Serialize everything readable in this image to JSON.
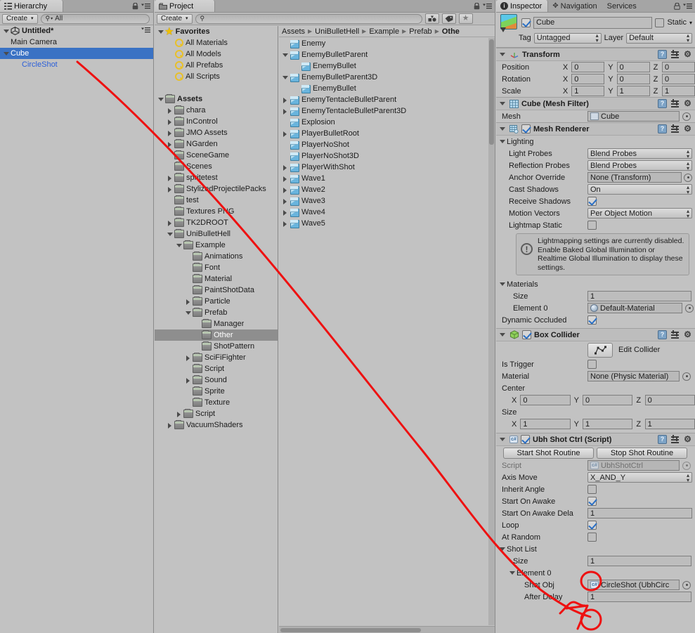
{
  "hierarchy": {
    "tab_label": "Hierarchy",
    "tab_icon": "hierarchy-icon",
    "create_label": "Create",
    "search_placeholder": "All",
    "search_value": "All",
    "scene_name": "Untitled*",
    "items": [
      {
        "label": "Main Camera",
        "depth": 1,
        "arrow": "none",
        "selected": false
      },
      {
        "label": "Cube",
        "depth": 1,
        "arrow": "down",
        "selected": true
      },
      {
        "label": "CircleShot",
        "depth": 2,
        "arrow": "none",
        "selected": false,
        "prefab": true
      }
    ]
  },
  "project": {
    "tab_label": "Project",
    "create_label": "Create",
    "search_value": "",
    "breadcrumb": [
      "Assets",
      "UniBulletHell",
      "Example",
      "Prefab",
      "Othe"
    ],
    "tree": [
      {
        "label": "Favorites",
        "depth": 0,
        "arrow": "down",
        "icon": "star-icon",
        "bold": true
      },
      {
        "label": "All Materials",
        "depth": 1,
        "arrow": "none",
        "icon": "search-icon"
      },
      {
        "label": "All Models",
        "depth": 1,
        "arrow": "none",
        "icon": "search-icon"
      },
      {
        "label": "All Prefabs",
        "depth": 1,
        "arrow": "none",
        "icon": "search-icon"
      },
      {
        "label": "All Scripts",
        "depth": 1,
        "arrow": "none",
        "icon": "search-icon"
      },
      {
        "label": "",
        "depth": 0,
        "arrow": "none",
        "icon": "none",
        "blank": true
      },
      {
        "label": "Assets",
        "depth": 0,
        "arrow": "down",
        "icon": "folder-icon",
        "bold": true
      },
      {
        "label": "chara",
        "depth": 1,
        "arrow": "right",
        "icon": "folder-icon"
      },
      {
        "label": "InControl",
        "depth": 1,
        "arrow": "right",
        "icon": "folder-icon"
      },
      {
        "label": "JMO Assets",
        "depth": 1,
        "arrow": "right",
        "icon": "folder-icon"
      },
      {
        "label": "NGarden",
        "depth": 1,
        "arrow": "right",
        "icon": "folder-icon"
      },
      {
        "label": "SceneGame",
        "depth": 1,
        "arrow": "none",
        "icon": "folder-icon"
      },
      {
        "label": "Scenes",
        "depth": 1,
        "arrow": "none",
        "icon": "folder-icon"
      },
      {
        "label": "spritetest",
        "depth": 1,
        "arrow": "right",
        "icon": "folder-icon"
      },
      {
        "label": "StylizedProjectilePacks",
        "depth": 1,
        "arrow": "right",
        "icon": "folder-icon"
      },
      {
        "label": "test",
        "depth": 1,
        "arrow": "none",
        "icon": "folder-icon"
      },
      {
        "label": "Textures PNG",
        "depth": 1,
        "arrow": "none",
        "icon": "folder-icon"
      },
      {
        "label": "TK2DROOT",
        "depth": 1,
        "arrow": "right",
        "icon": "folder-icon"
      },
      {
        "label": "UniBulletHell",
        "depth": 1,
        "arrow": "down",
        "icon": "folder-icon"
      },
      {
        "label": "Example",
        "depth": 2,
        "arrow": "down",
        "icon": "folder-icon"
      },
      {
        "label": "Animations",
        "depth": 3,
        "arrow": "none",
        "icon": "folder-icon"
      },
      {
        "label": "Font",
        "depth": 3,
        "arrow": "none",
        "icon": "folder-icon"
      },
      {
        "label": "Material",
        "depth": 3,
        "arrow": "none",
        "icon": "folder-icon"
      },
      {
        "label": "PaintShotData",
        "depth": 3,
        "arrow": "none",
        "icon": "folder-icon"
      },
      {
        "label": "Particle",
        "depth": 3,
        "arrow": "right",
        "icon": "folder-icon"
      },
      {
        "label": "Prefab",
        "depth": 3,
        "arrow": "down",
        "icon": "folder-icon"
      },
      {
        "label": "Manager",
        "depth": 4,
        "arrow": "none",
        "icon": "folder-icon"
      },
      {
        "label": "Other",
        "depth": 4,
        "arrow": "none",
        "icon": "folder-icon",
        "selected": true
      },
      {
        "label": "ShotPattern",
        "depth": 4,
        "arrow": "none",
        "icon": "folder-icon"
      },
      {
        "label": "SciFiFighter",
        "depth": 3,
        "arrow": "right",
        "icon": "folder-icon"
      },
      {
        "label": "Script",
        "depth": 3,
        "arrow": "none",
        "icon": "folder-icon"
      },
      {
        "label": "Sound",
        "depth": 3,
        "arrow": "right",
        "icon": "folder-icon"
      },
      {
        "label": "Sprite",
        "depth": 3,
        "arrow": "none",
        "icon": "folder-icon"
      },
      {
        "label": "Texture",
        "depth": 3,
        "arrow": "none",
        "icon": "folder-icon"
      },
      {
        "label": "Script",
        "depth": 2,
        "arrow": "right",
        "icon": "folder-icon"
      },
      {
        "label": "VacuumShaders",
        "depth": 1,
        "arrow": "right",
        "icon": "folder-icon"
      }
    ],
    "assets": [
      {
        "label": "Enemy",
        "depth": 1,
        "arrow": "none"
      },
      {
        "label": "EnemyBulletParent",
        "depth": 1,
        "arrow": "down"
      },
      {
        "label": "EnemyBullet",
        "depth": 2,
        "arrow": "none"
      },
      {
        "label": "EnemyBulletParent3D",
        "depth": 1,
        "arrow": "down"
      },
      {
        "label": "EnemyBullet",
        "depth": 2,
        "arrow": "none"
      },
      {
        "label": "EnemyTentacleBulletParent",
        "depth": 1,
        "arrow": "right"
      },
      {
        "label": "EnemyTentacleBulletParent3D",
        "depth": 1,
        "arrow": "right"
      },
      {
        "label": "Explosion",
        "depth": 1,
        "arrow": "none"
      },
      {
        "label": "PlayerBulletRoot",
        "depth": 1,
        "arrow": "right"
      },
      {
        "label": "PlayerNoShot",
        "depth": 1,
        "arrow": "none"
      },
      {
        "label": "PlayerNoShot3D",
        "depth": 1,
        "arrow": "none"
      },
      {
        "label": "PlayerWithShot",
        "depth": 1,
        "arrow": "right"
      },
      {
        "label": "Wave1",
        "depth": 1,
        "arrow": "right"
      },
      {
        "label": "Wave2",
        "depth": 1,
        "arrow": "right"
      },
      {
        "label": "Wave3",
        "depth": 1,
        "arrow": "right"
      },
      {
        "label": "Wave4",
        "depth": 1,
        "arrow": "right"
      },
      {
        "label": "Wave5",
        "depth": 1,
        "arrow": "right"
      }
    ]
  },
  "inspector": {
    "tabs": [
      {
        "label": "Inspector",
        "active": true,
        "icon": "info-icon"
      },
      {
        "label": "Navigation",
        "active": false,
        "icon": "navigation-icon"
      },
      {
        "label": "Services",
        "active": false,
        "icon": "none"
      }
    ],
    "object_name": "Cube",
    "object_enabled": true,
    "static_label": "Static",
    "static_checked": false,
    "tag_label": "Tag",
    "tag_value": "Untagged",
    "layer_label": "Layer",
    "layer_value": "Default",
    "transform": {
      "title": "Transform",
      "rows": [
        {
          "label": "Position",
          "x": "0",
          "y": "0",
          "z": "0"
        },
        {
          "label": "Rotation",
          "x": "0",
          "y": "0",
          "z": "0"
        },
        {
          "label": "Scale",
          "x": "1",
          "y": "1",
          "z": "1"
        }
      ]
    },
    "mesh_filter": {
      "title": "Cube (Mesh Filter)",
      "mesh_label": "Mesh",
      "mesh_value": "Cube"
    },
    "mesh_renderer": {
      "title": "Mesh Renderer",
      "enabled": true,
      "lighting_label": "Lighting",
      "light_probes_label": "Light Probes",
      "light_probes_value": "Blend Probes",
      "reflection_probes_label": "Reflection Probes",
      "reflection_probes_value": "Blend Probes",
      "anchor_override_label": "Anchor Override",
      "anchor_override_value": "None (Transform)",
      "cast_shadows_label": "Cast Shadows",
      "cast_shadows_value": "On",
      "receive_shadows_label": "Receive Shadows",
      "receive_shadows_checked": true,
      "motion_vectors_label": "Motion Vectors",
      "motion_vectors_value": "Per Object Motion",
      "lightmap_static_label": "Lightmap Static",
      "lightmap_static_checked": false,
      "info_text": "Lightmapping settings are currently disabled. Enable Baked Global Illumination or Realtime Global Illumination to display these settings.",
      "materials_label": "Materials",
      "size_label": "Size",
      "size_value": "1",
      "element0_label": "Element 0",
      "element0_value": "Default-Material",
      "dynamic_occluded_label": "Dynamic Occluded",
      "dynamic_occluded_checked": true
    },
    "box_collider": {
      "title": "Box Collider",
      "enabled": true,
      "edit_collider_label": "Edit Collider",
      "is_trigger_label": "Is Trigger",
      "is_trigger_checked": false,
      "material_label": "Material",
      "material_value": "None (Physic Material)",
      "center_label": "Center",
      "center": {
        "x": "0",
        "y": "0",
        "z": "0"
      },
      "size_label": "Size",
      "size": {
        "x": "1",
        "y": "1",
        "z": "1"
      }
    },
    "ubh_shot_ctrl": {
      "title": "Ubh Shot Ctrl (Script)",
      "enabled": true,
      "start_button": "Start Shot Routine",
      "stop_button": "Stop Shot Routine",
      "script_label": "Script",
      "script_value": "UbhShotCtrl",
      "axis_move_label": "Axis Move",
      "axis_move_value": "X_AND_Y",
      "inherit_angle_label": "Inherit Angle",
      "inherit_angle_checked": false,
      "start_on_awake_label": "Start On Awake",
      "start_on_awake_checked": true,
      "start_on_awake_delay_label": "Start On Awake Dela",
      "start_on_awake_delay_value": "1",
      "loop_label": "Loop",
      "loop_checked": true,
      "at_random_label": "At Random",
      "at_random_checked": false,
      "shot_list_label": "Shot List",
      "shot_list_size_label": "Size",
      "shot_list_size_value": "1",
      "element0_label": "Element 0",
      "shot_obj_label": "Shot Obj",
      "shot_obj_value": "CircleShot (UbhCirc",
      "after_delay_label": "After Delay",
      "after_delay_value": "1"
    }
  },
  "annotation": {
    "color": "#ee1111",
    "description": "red hand-drawn line from CircleShot in hierarchy to Shot Obj field, with circles around Size and After Delay values"
  }
}
